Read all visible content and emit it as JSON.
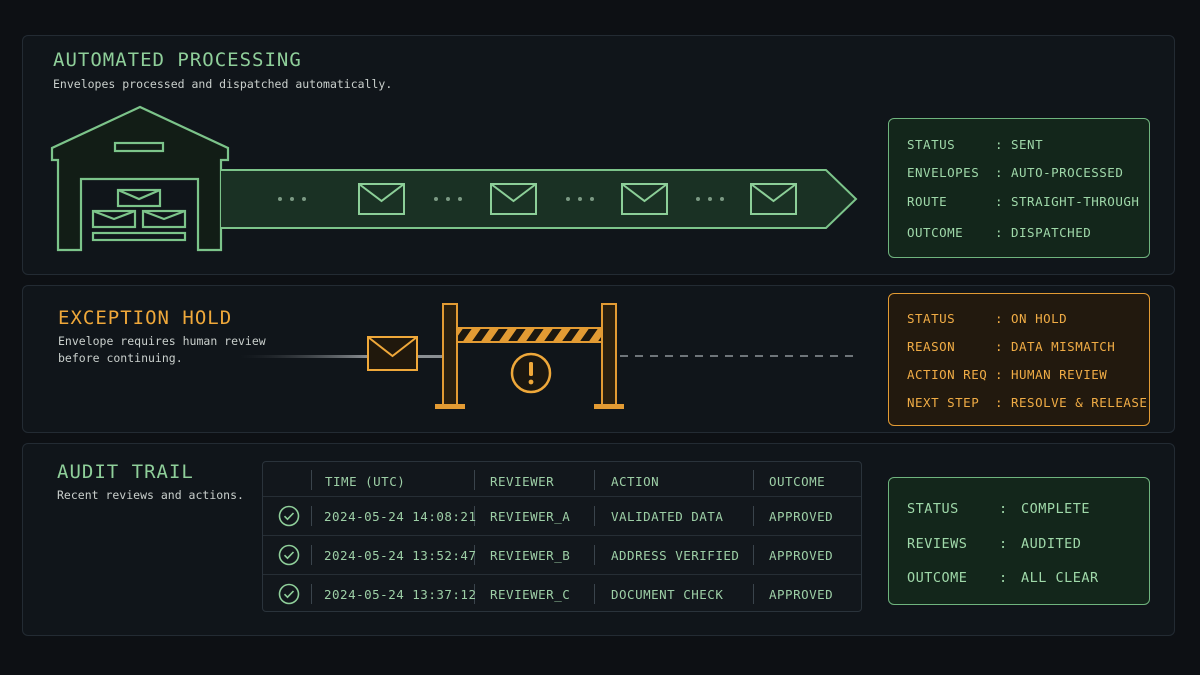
{
  "colors": {
    "green": "#8fcf9a",
    "amber": "#efa83a",
    "background": "#0d1014"
  },
  "automated": {
    "title": "AUTOMATED PROCESSING",
    "subtitle": "Envelopes processed and dispatched automatically.",
    "status_card": {
      "rows": [
        {
          "key": "STATUS",
          "value": "SENT"
        },
        {
          "key": "ENVELOPES",
          "value": "AUTO-PROCESSED"
        },
        {
          "key": "ROUTE",
          "value": "STRAIGHT-THROUGH"
        },
        {
          "key": "OUTCOME",
          "value": "DISPATCHED"
        }
      ]
    },
    "icons": [
      "warehouse-icon",
      "envelope-icon",
      "ellipsis-icon",
      "arrow-icon"
    ]
  },
  "exception": {
    "title": "EXCEPTION HOLD",
    "subtitle_line1": "Envelope requires human review",
    "subtitle_line2": "before continuing.",
    "status_card": {
      "rows": [
        {
          "key": "STATUS",
          "value": "ON HOLD"
        },
        {
          "key": "REASON",
          "value": "DATA MISMATCH"
        },
        {
          "key": "ACTION REQ",
          "value": "HUMAN REVIEW"
        },
        {
          "key": "NEXT STEP",
          "value": "RESOLVE & RELEASE"
        }
      ]
    },
    "icons": [
      "envelope-icon",
      "barrier-gate-icon",
      "warning-icon"
    ]
  },
  "audit": {
    "title": "AUDIT TRAIL",
    "subtitle": "Recent reviews and actions.",
    "columns": [
      "TIME (UTC)",
      "REVIEWER",
      "ACTION",
      "OUTCOME"
    ],
    "rows": [
      {
        "time": "2024-05-24 14:08:21",
        "reviewer": "REVIEWER_A",
        "action": "VALIDATED DATA",
        "outcome": "APPROVED"
      },
      {
        "time": "2024-05-24 13:52:47",
        "reviewer": "REVIEWER_B",
        "action": "ADDRESS VERIFIED",
        "outcome": "APPROVED"
      },
      {
        "time": "2024-05-24 13:37:12",
        "reviewer": "REVIEWER_C",
        "action": "DOCUMENT CHECK",
        "outcome": "APPROVED"
      }
    ],
    "status_card": {
      "rows": [
        {
          "key": "STATUS",
          "value": "COMPLETE"
        },
        {
          "key": "REVIEWS",
          "value": "AUDITED"
        },
        {
          "key": "OUTCOME",
          "value": "ALL CLEAR"
        }
      ]
    },
    "icons": [
      "check-circle-icon"
    ]
  }
}
